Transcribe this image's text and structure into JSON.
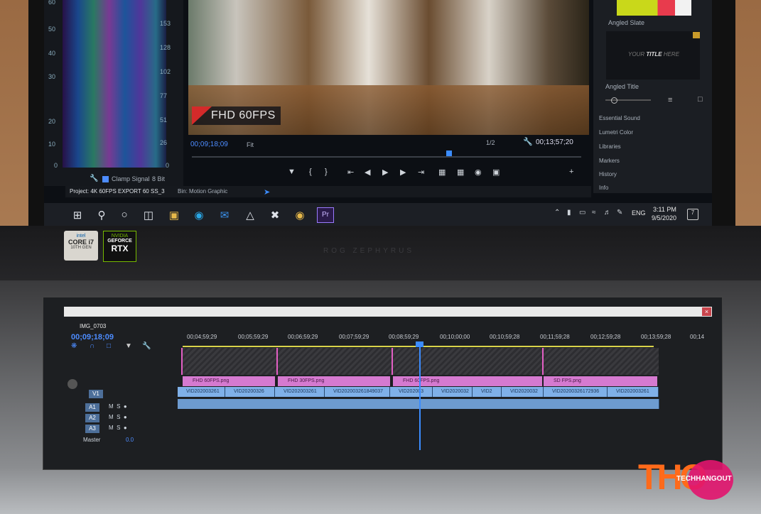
{
  "scopes": {
    "left_ticks": [
      "60",
      "50",
      "40",
      "30",
      "20",
      "10",
      "0"
    ],
    "right_ticks": [
      "153",
      "128",
      "102",
      "77",
      "51",
      "26",
      "0"
    ],
    "clamp_label": "Clamp Signal",
    "bit_depth": "8 Bit"
  },
  "monitor": {
    "overlay_label": "FHD 60FPS",
    "timecode_current": "00;09;18;09",
    "zoom": "Fit",
    "resolution": "1/2",
    "timecode_total": "00;13;57;20"
  },
  "project_bar": {
    "project_tab": "Project: 4K 60FPS EXPORT 60 SS_3",
    "bin_tab": "Bin: Motion Graphic"
  },
  "right_panel": {
    "item1": "Angled Slate",
    "title_placeholder_a": "YOUR",
    "title_placeholder_b": "TITLE",
    "title_placeholder_c": "HERE",
    "item2": "Angled Title",
    "menu": [
      "Essential Sound",
      "Lumetri Color",
      "Libraries",
      "Markers",
      "History",
      "Info"
    ]
  },
  "taskbar": {
    "lang": "ENG",
    "time": "3:11 PM",
    "date": "9/5/2020"
  },
  "deck": {
    "brand": "ROG ZEPHYRUS",
    "intel_a": "intel",
    "intel_b": "CORE i7",
    "intel_c": "10TH GEN",
    "nvidia_a": "NVIDIA",
    "nvidia_b": "GEFORCE",
    "nvidia_c": "RTX"
  },
  "timeline": {
    "sequence": "IMG_0703",
    "timecode": "00;09;18;09",
    "ruler": [
      "00;04;59;29",
      "00;05;59;29",
      "00;06;59;29",
      "00;07;59;29",
      "00;08;59;29",
      "00;10;00;00",
      "00;10;59;28",
      "00;11;59;28",
      "00;12;59;28",
      "00;13;59;28",
      "00;14"
    ],
    "tracks": [
      "V1",
      "A1",
      "A2",
      "A3"
    ],
    "master": "Master",
    "master_val": "0.0",
    "pink_clips": [
      "FHD 60FPS.png",
      "FHD 30FPS.png",
      "FHD 60FPS.png",
      "SD FPS.png"
    ],
    "blue_clips": [
      "VID202003261",
      "VID20200326",
      "VID202003261",
      "VID202003261849037",
      "VID202003",
      "VID2020032",
      "VID2",
      "VID2020032",
      "VID20200326172936",
      "VID202003261"
    ]
  },
  "logo": {
    "letters": "THO",
    "name": "TECHHANGOUT"
  },
  "colors": {
    "accent_blue": "#4d8cff",
    "clip_pink": "#d57ad0",
    "clip_blue": "#7fb0e8",
    "logo_orange": "#ff6a1a",
    "logo_magenta": "#e2146e"
  }
}
